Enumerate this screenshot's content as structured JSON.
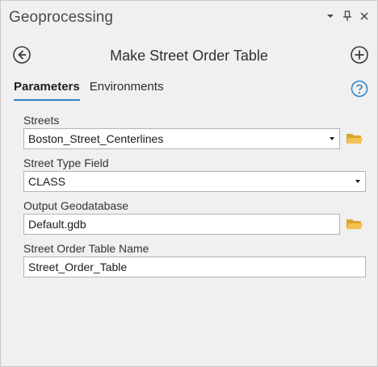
{
  "pane": {
    "title": "Geoprocessing",
    "options_icon": "chevron-down-icon",
    "pin_icon": "pin-icon",
    "close_icon": "close-icon"
  },
  "tool": {
    "title": "Make Street Order Table",
    "back_icon": "back-arrow-icon",
    "add_icon": "add-icon"
  },
  "tabs": [
    {
      "label": "Parameters",
      "active": true
    },
    {
      "label": "Environments",
      "active": false
    }
  ],
  "help_icon": "help-icon",
  "params": [
    {
      "label": "Streets",
      "value": "Boston_Street_Centerlines",
      "type": "dropdown",
      "browse": true
    },
    {
      "label": "Street Type Field",
      "value": "CLASS",
      "type": "dropdown",
      "browse": false
    },
    {
      "label": "Output Geodatabase",
      "value": "Default.gdb",
      "type": "text",
      "browse": true
    },
    {
      "label": "Street Order Table Name",
      "value": "Street_Order_Table",
      "type": "text",
      "browse": false
    }
  ],
  "colors": {
    "accent": "#2f7fc6",
    "folder": "#e3b341"
  }
}
